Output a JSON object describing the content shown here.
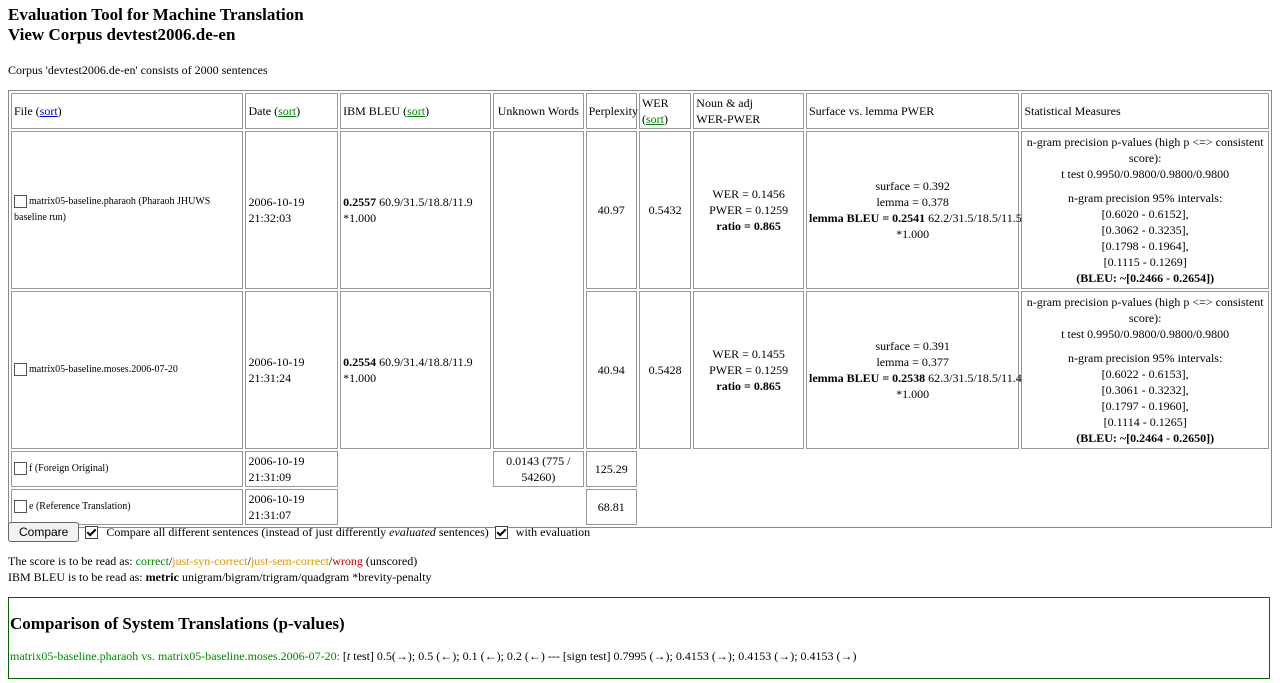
{
  "header": {
    "title": "Evaluation Tool for Machine Translation",
    "subtitle": "View Corpus devtest2006.de-en"
  },
  "summary": "Corpus 'devtest2006.de-en' consists of 2000 sentences",
  "table": {
    "headers": {
      "file": "File (",
      "date": "Date (",
      "bleu": "IBM BLEU (",
      "sort": "sort",
      "close_paren": ")",
      "unknown": "Unknown Words",
      "perplexity": "Perplexity",
      "wer": "WER",
      "wer_open": "(",
      "noun_adj": "Noun & adj",
      "wer_pwer": "WER-PWER",
      "surface": "Surface vs. lemma PWER",
      "stat": "Statistical Measures"
    },
    "rows": [
      {
        "file": "matrix05-baseline.pharaoh (Pharaoh JHUWS baseline run)",
        "date": "2006-10-19",
        "time": "21:32:03",
        "bleu_score": "0.2557",
        "bleu_rest": " 60.9/31.5/18.8/11.9",
        "bleu_bp": "*1.000",
        "perplexity": "40.97",
        "wer": "0.5432",
        "na_wer": "WER = 0.1456",
        "na_pwer": "PWER = 0.1259",
        "na_ratio": "ratio = 0.865",
        "surface": "surface = 0.392",
        "lemma": "lemma = 0.378",
        "lemma_bleu_label": "lemma BLEU = 0.2541",
        "lemma_bleu_rest": " 62.2/31.5/18.5/11.5",
        "lemma_bp": "*1.000",
        "stat_pvals_title": "n-gram precision p-values (high p <=> consistent score):",
        "stat_ttest": "t test 0.9950/0.9800/0.9800/0.9800",
        "stat_int_title": "n-gram precision 95% intervals:",
        "stat_i1": "[0.6020 - 0.6152],",
        "stat_i2": "[0.3062 - 0.3235],",
        "stat_i3": "[0.1798 - 0.1964],",
        "stat_i4": "[0.1115 - 0.1269]",
        "stat_bleu": "(BLEU: ~[0.2466 - 0.2654])"
      },
      {
        "file": "matrix05-baseline.moses.2006-07-20",
        "date": "2006-10-19",
        "time": "21:31:24",
        "bleu_score": "0.2554",
        "bleu_rest": " 60.9/31.4/18.8/11.9",
        "bleu_bp": "*1.000",
        "perplexity": "40.94",
        "wer": "0.5428",
        "na_wer": "WER = 0.1455",
        "na_pwer": "PWER = 0.1259",
        "na_ratio": "ratio = 0.865",
        "surface": "surface = 0.391",
        "lemma": "lemma = 0.377",
        "lemma_bleu_label": "lemma BLEU = 0.2538",
        "lemma_bleu_rest": " 62.3/31.5/18.5/11.4",
        "lemma_bp": "*1.000",
        "stat_pvals_title": "n-gram precision p-values (high p <=> consistent score):",
        "stat_ttest": "t test 0.9950/0.9800/0.9800/0.9800",
        "stat_int_title": "n-gram precision 95% intervals:",
        "stat_i1": "[0.6022 - 0.6153],",
        "stat_i2": "[0.3061 - 0.3232],",
        "stat_i3": "[0.1797 - 0.1960],",
        "stat_i4": "[0.1114 - 0.1265]",
        "stat_bleu": "(BLEU: ~[0.2464 - 0.2650])"
      }
    ],
    "foreign": {
      "file": "f (Foreign Original)",
      "date": "2006-10-19",
      "time": "21:31:09",
      "unknown": "0.0143 (775 / 54260)",
      "perplexity": "125.29"
    },
    "reference": {
      "file": "e (Reference Translation)",
      "date": "2006-10-19",
      "time": "21:31:07",
      "perplexity": "68.81"
    }
  },
  "controls": {
    "compare_button": "Compare",
    "compare_all_label_pre": "Compare all different sentences (instead of just differently ",
    "compare_all_label_em": "evaluated",
    "compare_all_label_post": " sentences)",
    "with_eval_label": "with evaluation"
  },
  "legend": {
    "score_pre": "The score is to be read as: ",
    "correct": "correct",
    "slash": "/",
    "syn": "just-syn-correct",
    "sem": "just-sem-correct",
    "wrong": "wrong",
    "unscored": " (unscored)",
    "bleu_pre": "IBM BLEU is to be read as: ",
    "bleu_metric": "metric",
    "bleu_post": " unigram/bigram/trigram/quadgram *brevity-penalty"
  },
  "comparison": {
    "title": "Comparison of System Translations (p-values)",
    "pair": "matrix05-baseline.pharaoh vs. matrix05-baseline.moses.2006-07-20:",
    "ttest_open": " [",
    "ttest_t": "t",
    "ttest_rest": " test] 0.5(→); 0.5 (←); 0.1 (←); 0.2 (←)  ---  [sign test] 0.7995 (→); 0.4153 (→); 0.4153 (→); 0.4153 (→)"
  },
  "colors": {
    "link_blue": "#0000cc",
    "link_green": "#008800",
    "wrong_red": "#cc0000",
    "syn_orange": "#dd9900"
  }
}
